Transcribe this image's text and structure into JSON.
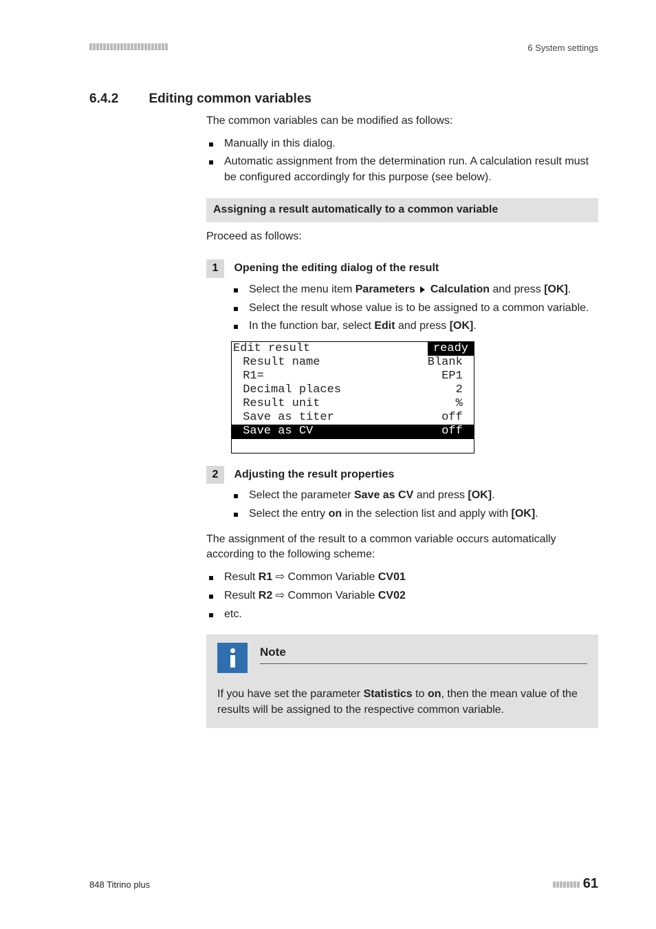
{
  "header": {
    "right": "6 System settings"
  },
  "section": {
    "num": "6.4.2",
    "title": "Editing common variables"
  },
  "intro": "The common variables can be modified as follows:",
  "intro_bullets": [
    "Manually in this dialog.",
    "Automatic assignment from the determination run. A calculation result must be configured accordingly for this purpose (see below)."
  ],
  "grayheading": "Assigning a result automatically to a common variable",
  "proceed": "Proceed as follows:",
  "step1": {
    "num": "1",
    "title": "Opening the editing dialog of the result",
    "b1_pre": "Select the menu item ",
    "b1_b1": "Parameters",
    "b1_b2": "Calculation",
    "b1_mid": " and press ",
    "b1_ok": "[OK]",
    "b1_post": ".",
    "b2": "Select the result whose value is to be assigned to a common variable.",
    "b3_pre": "In the function bar, select ",
    "b3_b": "Edit",
    "b3_mid": " and press ",
    "b3_ok": "[OK]",
    "b3_post": "."
  },
  "lcd": {
    "title_left": "Edit result",
    "title_right": "ready",
    "rows": [
      {
        "l": " Result name",
        "r": "Blank "
      },
      {
        "l": " R1=",
        "r": "EP1 "
      },
      {
        "l": " Decimal places",
        "r": "2 "
      },
      {
        "l": " Result unit",
        "r": "% "
      },
      {
        "l": " Save as titer",
        "r": "off "
      }
    ],
    "invrow": {
      "l": " Save as CV",
      "r": "off "
    }
  },
  "step2": {
    "num": "2",
    "title": "Adjusting the result properties",
    "b1_pre": "Select the parameter ",
    "b1_b": "Save as CV",
    "b1_mid": " and press ",
    "b1_ok": "[OK]",
    "b1_post": ".",
    "b2_pre": "Select the entry ",
    "b2_b": "on",
    "b2_mid": " in the selection list and apply with ",
    "b2_ok": "[OK]",
    "b2_post": "."
  },
  "assignpara": "The assignment of the result to a common variable occurs automatically according to the following scheme:",
  "scheme": {
    "r1a": "Result ",
    "r1b": "R1",
    "r1c": " ⇨ Common Variable ",
    "r1d": "CV01",
    "r2a": "Result ",
    "r2b": "R2",
    "r2c": " ⇨ Common Variable ",
    "r2d": "CV02",
    "r3": "etc."
  },
  "note": {
    "title": "Note",
    "t1": "If you have set the parameter ",
    "tb1": "Statistics",
    "t2": " to ",
    "tb2": "on",
    "t3": ", then the mean value of the results will be assigned to the respective common variable."
  },
  "footer": {
    "left": "848 Titrino plus",
    "page": "61"
  }
}
